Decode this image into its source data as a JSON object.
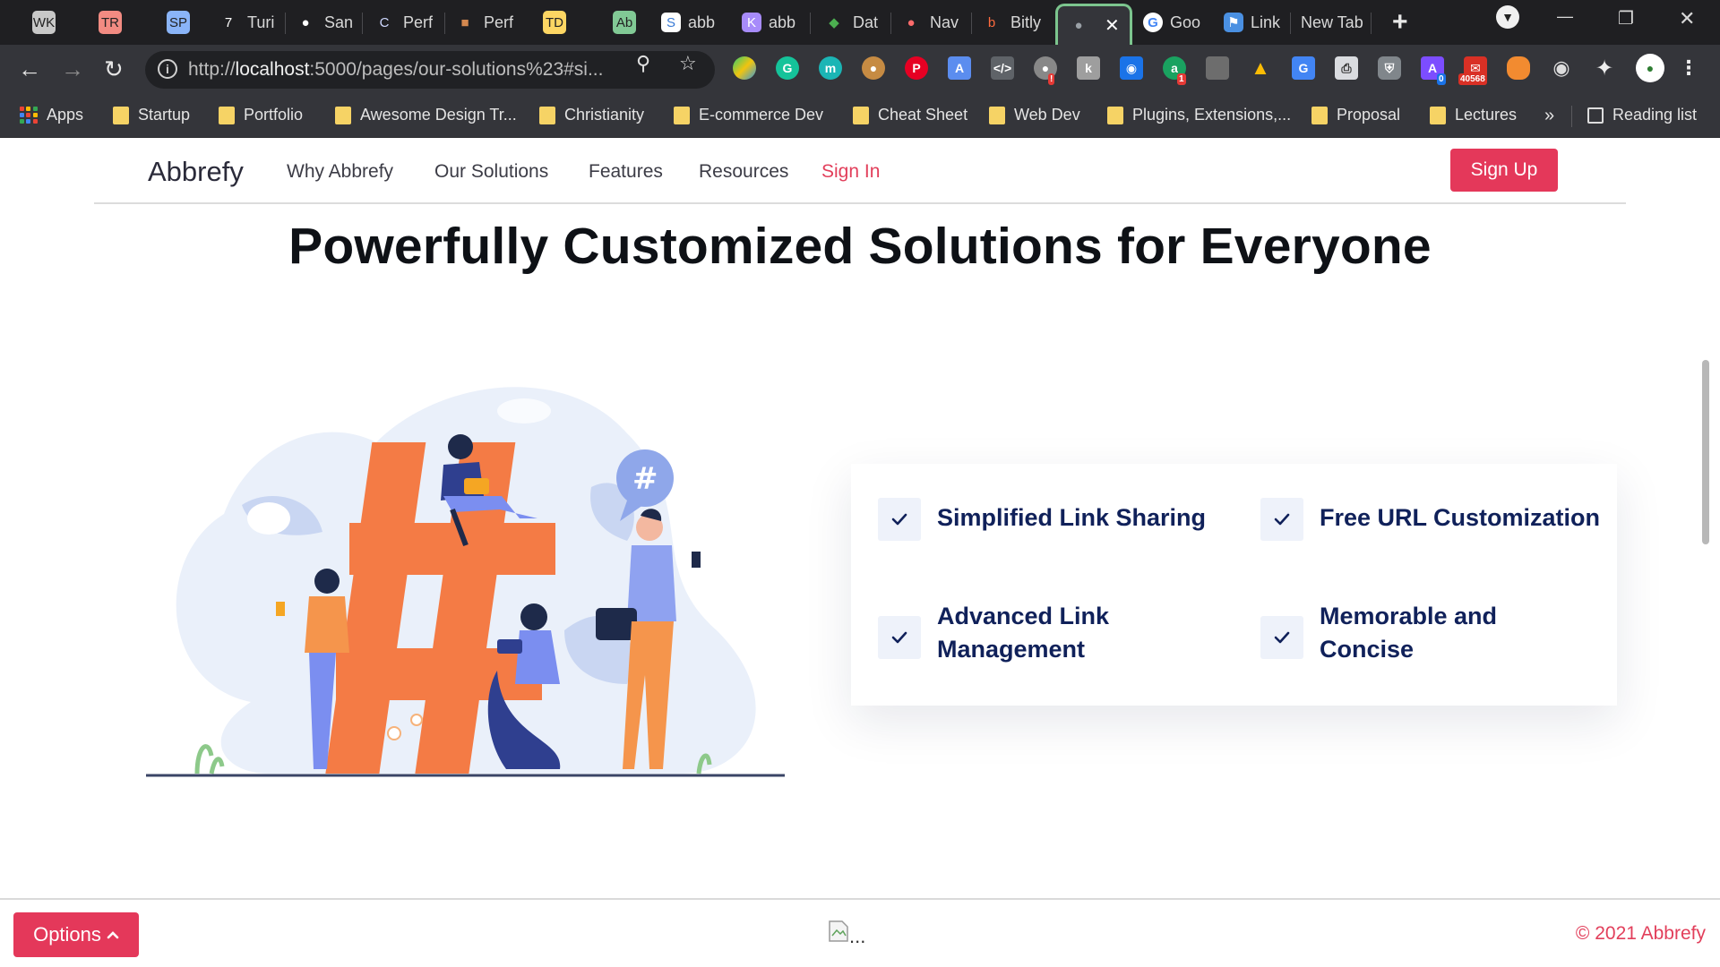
{
  "browser": {
    "tabs": [
      {
        "label": "",
        "favicon_text": "WK",
        "favicon_color": "#c8c8c8",
        "group_color": "#c8c8c8"
      },
      {
        "label": "",
        "favicon_text": "TR",
        "favicon_color": "#f28b82",
        "group_color": "#f28b82"
      },
      {
        "label": "",
        "favicon_text": "SP",
        "favicon_color": "#8ab4f8",
        "group_color": "#8ab4f8"
      },
      {
        "label": "Turi",
        "favicon_text": "7"
      },
      {
        "label": "San",
        "favicon_text": "●"
      },
      {
        "label": "Perf",
        "favicon_text": "C"
      },
      {
        "label": "Perf",
        "favicon_text": "■"
      },
      {
        "label": "",
        "favicon_text": "TD",
        "favicon_color": "#fdd663",
        "group_color": "#fdd663"
      },
      {
        "label": "",
        "favicon_text": "Ab",
        "favicon_color": "#81c995",
        "group_color": "#81c995"
      },
      {
        "label": "abb",
        "favicon_text": "S"
      },
      {
        "label": "abb",
        "favicon_text": "K"
      },
      {
        "label": "Dat",
        "favicon_text": "◆"
      },
      {
        "label": "Nav",
        "favicon_text": "●"
      },
      {
        "label": "Bitly",
        "favicon_text": "b"
      },
      {
        "label": "",
        "favicon_text": "●",
        "active": true
      },
      {
        "label": "Goo",
        "favicon_text": "G"
      },
      {
        "label": "Link",
        "favicon_text": "⚑"
      },
      {
        "label": "New Tab",
        "favicon_text": ""
      }
    ],
    "active_tab_close": "✕",
    "new_tab_symbol": "+",
    "window_controls": {
      "minimize": "—",
      "restore": "❐",
      "close": "✕"
    },
    "nav": {
      "back": "←",
      "forward": "→",
      "reload": "↻"
    },
    "address": {
      "protocol": "http://",
      "host": "localhost",
      "rest": ":5000/pages/our-solutions%23#si..."
    },
    "extension_badges": {
      "mail_count": "40568",
      "a_count": "1",
      "ext_count": "0"
    },
    "bookmarks": [
      {
        "label": "Apps",
        "type": "apps"
      },
      {
        "label": "Startup"
      },
      {
        "label": "Portfolio"
      },
      {
        "label": "Awesome Design Tr..."
      },
      {
        "label": "Christianity"
      },
      {
        "label": "E-commerce Dev"
      },
      {
        "label": "Cheat Sheet"
      },
      {
        "label": "Web Dev"
      },
      {
        "label": "Plugins, Extensions,..."
      },
      {
        "label": "Proposal"
      },
      {
        "label": "Lectures"
      }
    ],
    "bookmarks_overflow": "»",
    "reading_list": "Reading list"
  },
  "site": {
    "brand": "Abbrefy",
    "nav_links": [
      "Why Abbrefy",
      "Our Solutions",
      "Features",
      "Resources"
    ],
    "signin_label": "Sign In",
    "signup_label": "Sign Up",
    "hero_title": "Powerfully Customized Solutions for Everyone",
    "features": [
      "Simplified Link Sharing",
      "Free URL Customization",
      "Advanced Link Management",
      "Memorable and Concise"
    ],
    "footer": {
      "options_label": "Options",
      "broken_image_text": "...",
      "copyright": "© 2021 Abbrefy"
    },
    "colors": {
      "accent": "#e4385a",
      "feature_text": "#10215a",
      "hashtag": "#f47b45"
    }
  }
}
